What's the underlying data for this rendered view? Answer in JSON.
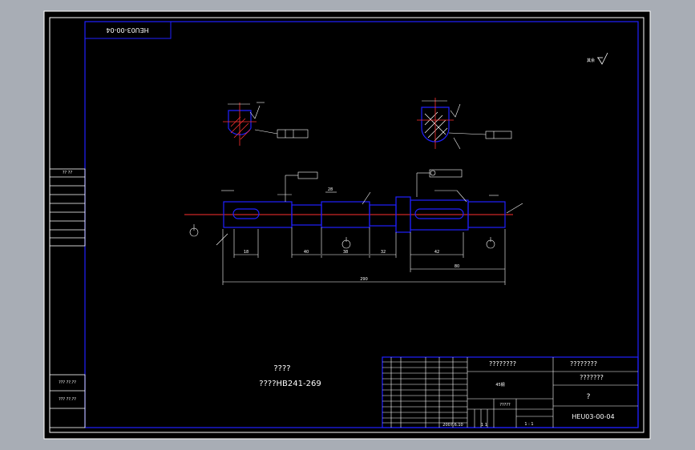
{
  "drawing": {
    "number_rotated": "HEU03-00-04",
    "number": "HEU03-00-04",
    "requirements_heading": "????",
    "requirements_text": "????HB241-269",
    "roughness_note": "其余",
    "title_block": {
      "material_row": "????????",
      "designer_label": "????????",
      "part_name": "???????",
      "scale_mark": "?",
      "mass_label": "?????",
      "qty_label": "45钢",
      "date": "2007.6.10",
      "sheet": "1 1",
      "ratio": "1 : 1"
    },
    "side_labels": [
      "?? ??",
      "??? ??.??",
      "??? ??.??"
    ],
    "dimensions": {
      "overall": "290",
      "right_span": "80",
      "seg_a": "18",
      "seg_b": "40",
      "seg_c": "38",
      "seg_d": "32",
      "seg_e": "42",
      "seg_f": "28"
    }
  }
}
